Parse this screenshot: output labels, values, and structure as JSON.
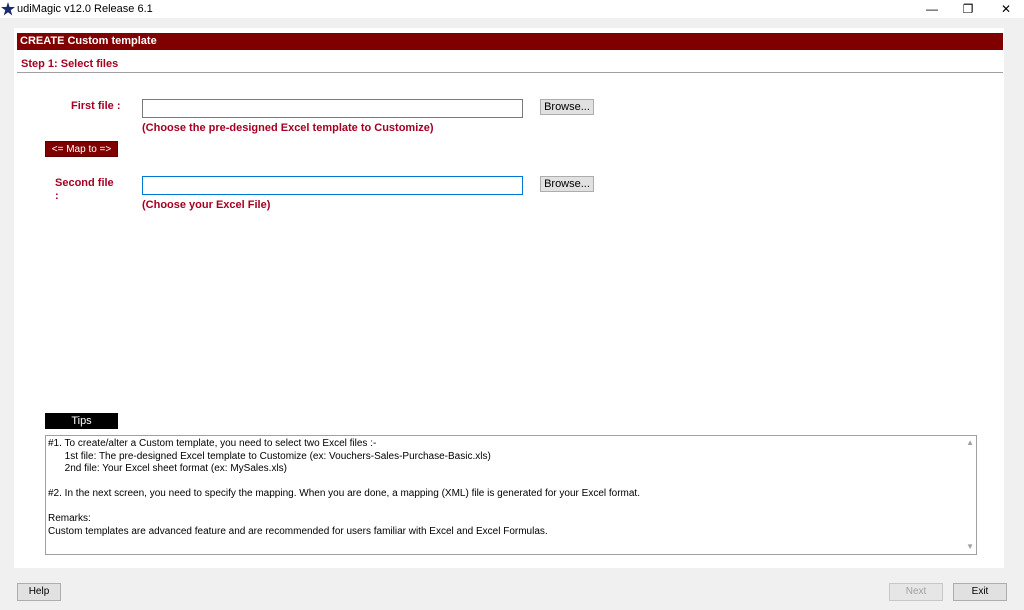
{
  "window": {
    "title": "udiMagic v12.0 Release 6.1",
    "app_icon": "star-icon",
    "minimize_glyph": "—",
    "restore_glyph": "❐",
    "close_glyph": "✕"
  },
  "header": {
    "title": "CREATE Custom template"
  },
  "step": {
    "title": "Step 1: Select files"
  },
  "first_file": {
    "label": "First file :",
    "value": "",
    "browse_label": "Browse...",
    "hint": "(Choose the pre-designed Excel template to Customize)"
  },
  "map_button": {
    "label": "<= Map to =>"
  },
  "second_file": {
    "label_line1": "Second file",
    "label_line2": ":",
    "value": "",
    "browse_label": "Browse...",
    "hint": "(Choose your Excel File)"
  },
  "tips": {
    "tab_label": "Tips",
    "lines": [
      "#1. To create/alter a Custom template, you need to select two Excel files :-",
      "      1st file: The pre-designed Excel template to Customize (ex: Vouchers-Sales-Purchase-Basic.xls)",
      "      2nd file: Your Excel sheet format (ex: MySales.xls)",
      "",
      "#2. In the next screen, you need to specify the mapping. When you are done, a mapping (XML) file is generated for your Excel format.",
      "",
      "Remarks:",
      "Custom templates are advanced feature and are recommended for users familiar with Excel and Excel Formulas."
    ]
  },
  "footer": {
    "help_label": "Help",
    "next_label": "Next",
    "exit_label": "Exit"
  },
  "colors": {
    "header_bg": "#800000",
    "label_red": "#a50021"
  }
}
